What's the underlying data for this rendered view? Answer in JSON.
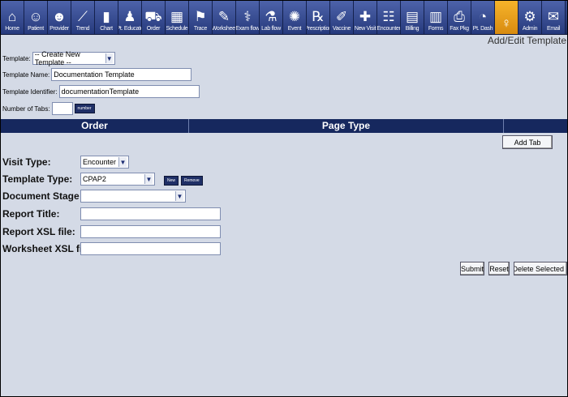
{
  "toolbar": {
    "items": [
      {
        "label": "Home",
        "icon": "home-icon",
        "glyph": "⌂"
      },
      {
        "label": "Patient",
        "icon": "patient-icon",
        "glyph": "☺"
      },
      {
        "label": "Provider",
        "icon": "provider-icon",
        "glyph": "☻"
      },
      {
        "label": "Trend",
        "icon": "trend-icon",
        "glyph": "⟋"
      },
      {
        "label": "Chart",
        "icon": "chart-icon",
        "glyph": "▮"
      },
      {
        "label": "Pt. Educate",
        "icon": "educate-icon",
        "glyph": "♟"
      },
      {
        "label": "Order",
        "icon": "order-icon",
        "glyph": "⛟"
      },
      {
        "label": "Schedule",
        "icon": "schedule-icon",
        "glyph": "▦"
      },
      {
        "label": "Trace",
        "icon": "trace-icon",
        "glyph": "⚑"
      },
      {
        "label": "Worksheet",
        "icon": "worksheet-icon",
        "glyph": "✎"
      },
      {
        "label": "Exam flow",
        "icon": "exam-flow-icon",
        "glyph": "⚕"
      },
      {
        "label": "Lab flow",
        "icon": "lab-flow-icon",
        "glyph": "⚗"
      },
      {
        "label": "Event",
        "icon": "event-icon",
        "glyph": "✺"
      },
      {
        "label": "Prescription",
        "icon": "prescription-icon",
        "glyph": "℞"
      },
      {
        "label": "Vaccine",
        "icon": "vaccine-icon",
        "glyph": "✐"
      },
      {
        "label": "New Visit",
        "icon": "new-visit-icon",
        "glyph": "✚"
      },
      {
        "label": "Encounter",
        "icon": "encounter-icon",
        "glyph": "☷"
      },
      {
        "label": "Billing",
        "icon": "billing-icon",
        "glyph": "▤"
      },
      {
        "label": "Forms",
        "icon": "forms-icon",
        "glyph": "▥"
      },
      {
        "label": "Fax Pkg",
        "icon": "fax-icon",
        "glyph": "⎙"
      },
      {
        "label": "Pt. Dash",
        "icon": "dashboard-icon",
        "glyph": "◔"
      },
      {
        "label": "",
        "icon": "body-figure-icon",
        "glyph": "♀",
        "active": true
      },
      {
        "label": "Admin",
        "icon": "admin-gear-icon",
        "glyph": "⚙"
      },
      {
        "label": "Email",
        "icon": "email-icon",
        "glyph": "✉"
      }
    ]
  },
  "page_title": "Add/Edit Template",
  "form": {
    "template_label": "Template:",
    "template_value": "-- Create New Template --",
    "name_label": "Template Name:",
    "name_value": "Documentation Template",
    "identifier_label": "Template Identifier:",
    "identifier_value": "documentationTemplate",
    "tabs_label": "Number of Tabs:",
    "tabs_value": "",
    "tabs_button": "number"
  },
  "table": {
    "col_order": "Order",
    "col_page_type": "Page Type",
    "add_tab": "Add Tab"
  },
  "details": {
    "visit_type_label": "Visit Type:",
    "visit_type_value": "Encounter",
    "template_type_label": "Template Type:",
    "template_type_value": "CPAP2",
    "new_button": "New",
    "remove_button": "Remove",
    "document_stage_label": "Document Stage",
    "document_stage_value": "",
    "report_title_label": "Report Title:",
    "report_xsl_label": "Report XSL file:",
    "worksheet_xsl_label": "Worksheet XSL file:"
  },
  "actions": {
    "submit": "Submit",
    "reset": "Reset",
    "delete": "Delete Selected"
  },
  "colors": {
    "toolbar": "#263a7c",
    "active_button": "#f6b42a",
    "page_bg": "#d4dae6",
    "header_bar": "#16285e"
  }
}
